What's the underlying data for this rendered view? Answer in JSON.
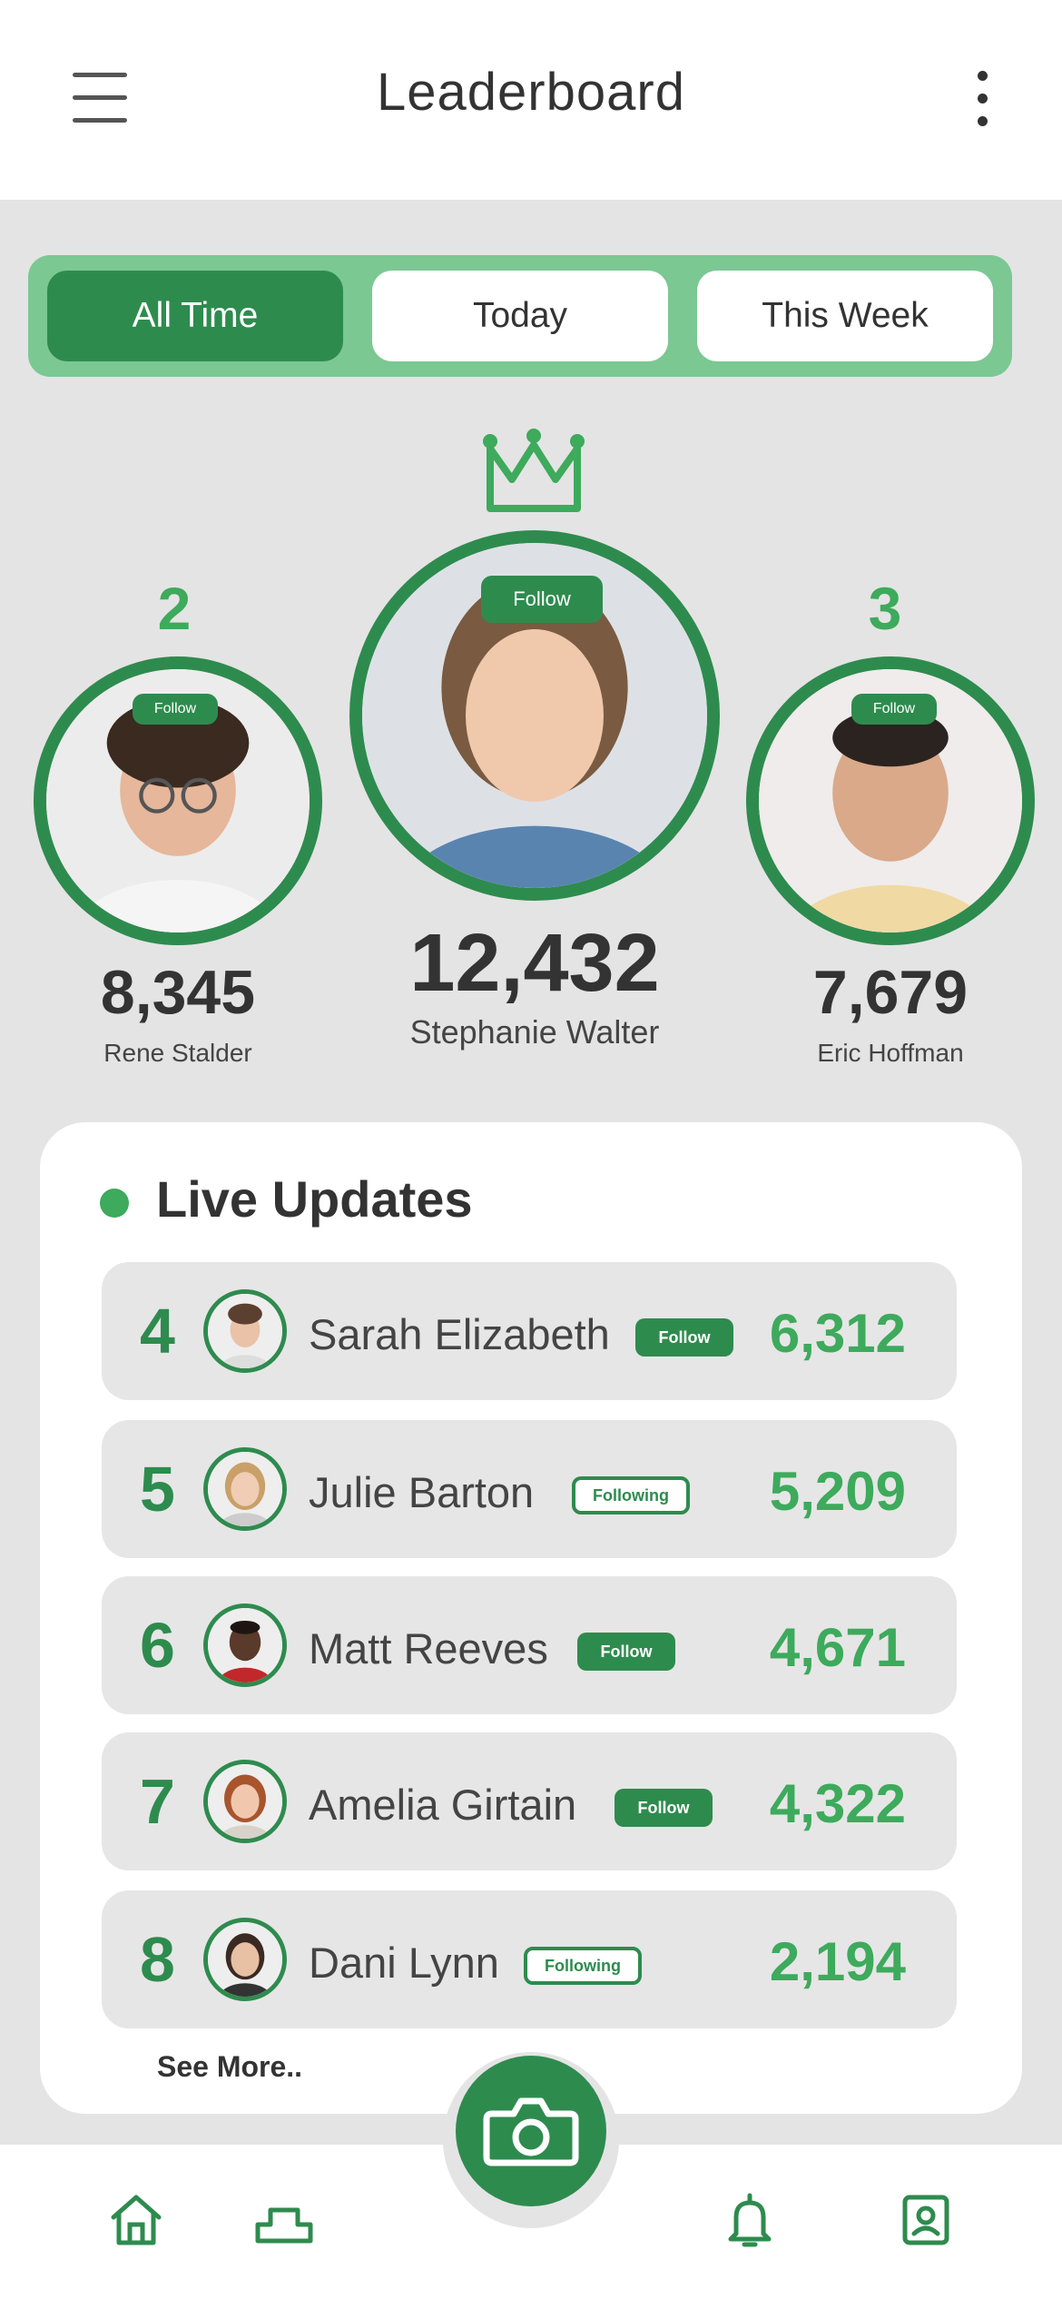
{
  "header": {
    "title": "Leaderboard",
    "menu_icon": "hamburger-menu-icon",
    "more_icon": "more-vertical-icon"
  },
  "tabs": [
    {
      "label": "All Time",
      "active": true
    },
    {
      "label": "Today",
      "active": false
    },
    {
      "label": "This Week",
      "active": false
    }
  ],
  "podium": {
    "first": {
      "rank": "1",
      "name": "Stephanie Walter",
      "score": "12,432",
      "button": "Follow"
    },
    "second": {
      "rank": "2",
      "name": "Rene Stalder",
      "score": "8,345",
      "button": "Follow"
    },
    "third": {
      "rank": "3",
      "name": "Eric Hoffman",
      "score": "7,679",
      "button": "Follow"
    }
  },
  "live_updates": {
    "title": "Live Updates",
    "rows": [
      {
        "rank": "4",
        "name": "Sarah Elizabeth",
        "button": "Follow",
        "score": "6,312"
      },
      {
        "rank": "5",
        "name": "Julie Barton",
        "button": "Following",
        "score": "5,209"
      },
      {
        "rank": "6",
        "name": "Matt Reeves",
        "button": "Follow",
        "score": "4,671"
      },
      {
        "rank": "7",
        "name": "Amelia Girtain",
        "button": "Follow",
        "score": "4,322"
      },
      {
        "rank": "8",
        "name": "Dani Lynn",
        "button": "Following",
        "score": "2,194"
      }
    ],
    "see_more": "See More.."
  },
  "bottom_nav": {
    "items": [
      "home-icon",
      "podium-icon",
      "camera-icon",
      "bell-icon",
      "profile-icon"
    ]
  },
  "colors": {
    "primary": "#2e8b4e",
    "accent": "#3daa5c",
    "tab_bg": "#7bc893",
    "background": "#e4e4e4"
  }
}
